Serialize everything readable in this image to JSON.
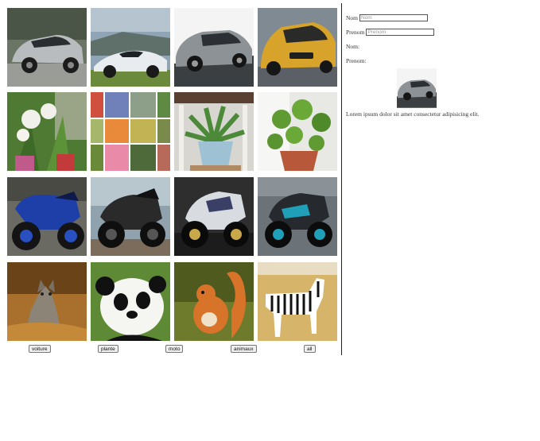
{
  "gallery": {
    "tiles": [
      {
        "category": "voiture",
        "subject": "white-sedan-icon",
        "colors": [
          "#6b7565",
          "#b9bcbe"
        ]
      },
      {
        "category": "voiture",
        "subject": "white-supercar-icon",
        "colors": [
          "#8fa4b4",
          "#e9ecef"
        ]
      },
      {
        "category": "voiture",
        "subject": "grey-sedan-icon",
        "colors": [
          "#f4f4f4",
          "#8d9296"
        ]
      },
      {
        "category": "voiture",
        "subject": "yellow-hatchback-icon",
        "colors": [
          "#7f8a92",
          "#d7a32a"
        ]
      },
      {
        "category": "plante",
        "subject": "lily-plants-icon",
        "colors": [
          "#4f7a34",
          "#f2f0ea"
        ]
      },
      {
        "category": "plante",
        "subject": "flower-collage-icon",
        "colors": [
          "#6f8f4a",
          "#e88a7a"
        ]
      },
      {
        "category": "plante",
        "subject": "potted-plant-icon",
        "colors": [
          "#d8d6d0",
          "#4c8a3a"
        ]
      },
      {
        "category": "plante",
        "subject": "pilea-plant-icon",
        "colors": [
          "#e8e8e4",
          "#5f9a32"
        ]
      },
      {
        "category": "moto",
        "subject": "blue-motorcycle-icon",
        "colors": [
          "#6a6a62",
          "#1f3fa8"
        ]
      },
      {
        "category": "moto",
        "subject": "black-motorcycle-icon",
        "colors": [
          "#8fa2ae",
          "#2a2a2a"
        ]
      },
      {
        "category": "moto",
        "subject": "white-motorcycle-icon",
        "colors": [
          "#2e2e2e",
          "#d8dbe0"
        ]
      },
      {
        "category": "moto",
        "subject": "cyan-motorcycle-icon",
        "colors": [
          "#6b7278",
          "#1f9fb8"
        ]
      },
      {
        "category": "animaux",
        "subject": "wolf-icon",
        "colors": [
          "#a8702c",
          "#8d8478"
        ]
      },
      {
        "category": "animaux",
        "subject": "panda-icon",
        "colors": [
          "#5e8a36",
          "#f5f5f2"
        ]
      },
      {
        "category": "animaux",
        "subject": "squirrel-icon",
        "colors": [
          "#6e7a2c",
          "#d8742a"
        ]
      },
      {
        "category": "animaux",
        "subject": "zebra-icon",
        "colors": [
          "#d6b56a",
          "#ffffff"
        ]
      }
    ]
  },
  "filters": [
    {
      "label": "voiture"
    },
    {
      "label": "plante"
    },
    {
      "label": "moto"
    },
    {
      "label": "animaux"
    },
    {
      "label": "all"
    }
  ],
  "form": {
    "nom_label": "Nom",
    "nom_placeholder": "Nom",
    "prenom_label": "Prenom",
    "prenom_placeholder": "Prenom",
    "nom_display_label": "Nom:",
    "prenom_display_label": "Prenom:"
  },
  "preview": {
    "subject": "grey-sedan-icon"
  },
  "description": "Lorem ipsum dolor sit amet consectetur adipisicing elit."
}
